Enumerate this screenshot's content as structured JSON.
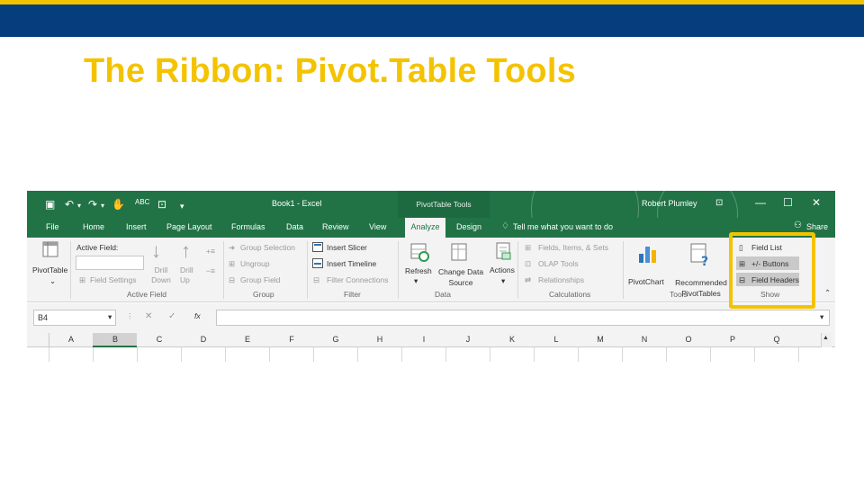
{
  "slide": {
    "title": "The Ribbon: Pivot.Table Tools",
    "colors": {
      "accent_gold": "#f4c300",
      "band_navy": "#063e7d",
      "excel_green": "#217346"
    }
  },
  "excel": {
    "window_title": "Book1 - Excel",
    "context_tab_group": "PivotTable Tools",
    "user": "Robert Plumley",
    "quick_access": [
      "save-icon",
      "undo-icon",
      "redo-icon",
      "touch-icon",
      "spelling-icon",
      "form-icon",
      "customize-icon"
    ],
    "window_buttons": [
      "ribbon-display-icon",
      "minimize-icon",
      "restore-icon",
      "close-icon"
    ],
    "tabs": [
      "File",
      "Home",
      "Insert",
      "Page Layout",
      "Formulas",
      "Data",
      "Review",
      "View",
      "Analyze",
      "Design"
    ],
    "active_tab": "Analyze",
    "tell_me": "Tell me what you want to do",
    "share": "Share",
    "ribbon": {
      "pivottable": {
        "label": "PivotTable"
      },
      "active_field": {
        "label": "Active Field:",
        "field_settings": "Field Settings",
        "drill_down": "Drill Down",
        "drill_up": "Drill Up",
        "group_name": "Active Field"
      },
      "group": {
        "group_selection": "Group Selection",
        "ungroup": "Ungroup",
        "group_field": "Group Field",
        "group_name": "Group"
      },
      "filter": {
        "insert_slicer": "Insert Slicer",
        "insert_timeline": "Insert Timeline",
        "filter_connections": "Filter Connections",
        "group_name": "Filter"
      },
      "data": {
        "refresh": "Refresh",
        "change_data_source": "Change Data Source",
        "group_name": "Data"
      },
      "actions": {
        "label": "Actions"
      },
      "calculations": {
        "fields_items_sets": "Fields, Items, & Sets",
        "olap_tools": "OLAP Tools",
        "relationships": "Relationships",
        "group_name": "Calculations"
      },
      "tools": {
        "pivotchart": "PivotChart",
        "recommended_pivottables": "Recommended PivotTables",
        "group_name": "Tools"
      },
      "show": {
        "field_list": "Field List",
        "buttons": "+/- Buttons",
        "field_headers": "Field Headers",
        "group_name": "Show"
      }
    },
    "name_box": "B4",
    "fx_label": "fx",
    "columns": [
      "A",
      "B",
      "C",
      "D",
      "E",
      "F",
      "G",
      "H",
      "I",
      "J",
      "K",
      "L",
      "M",
      "N",
      "O",
      "P",
      "Q"
    ],
    "selected_column": "B"
  }
}
